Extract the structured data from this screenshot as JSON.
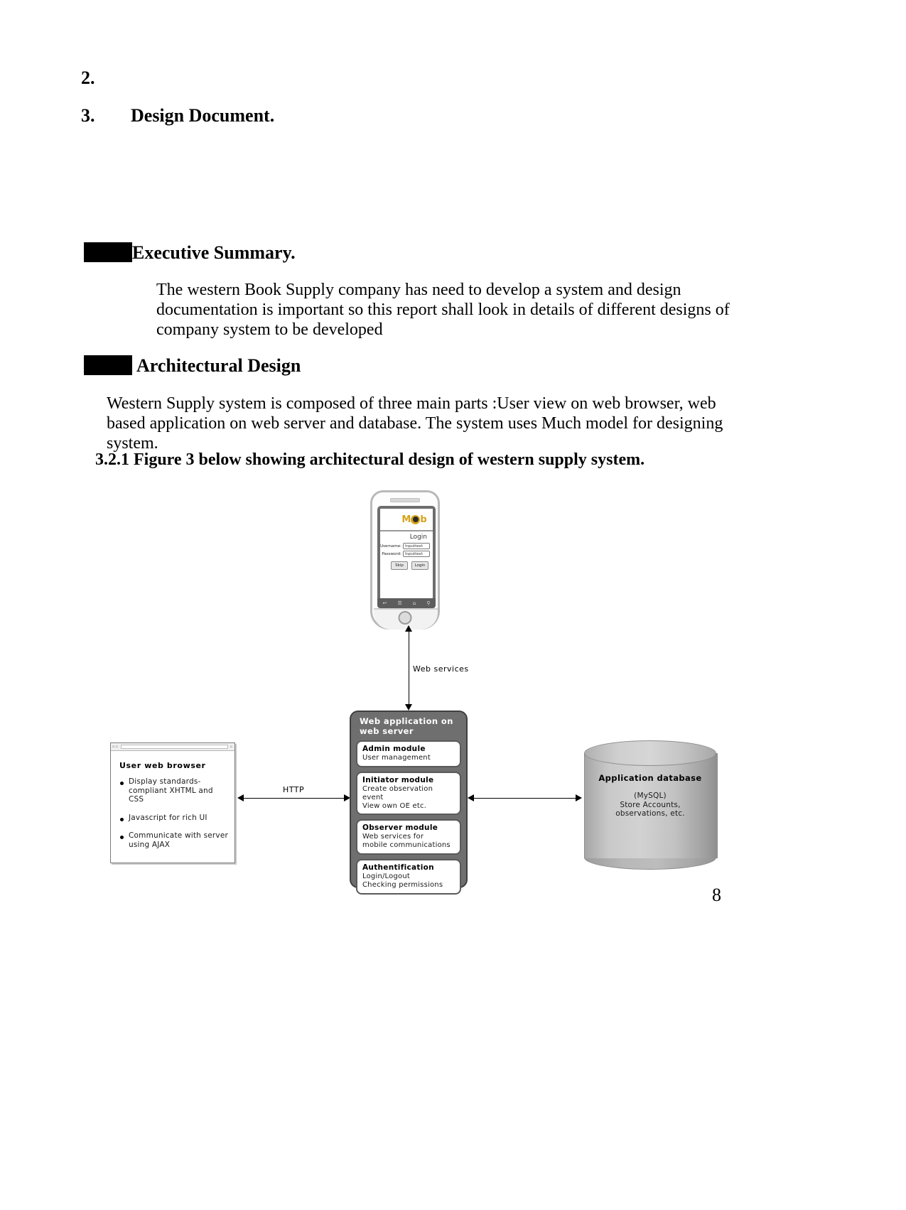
{
  "document": {
    "list_item_2": "2.",
    "section_number": "3.",
    "section_title": "Design Document.",
    "exec_summary_heading": "Executive Summary.",
    "exec_summary_body": "The western Book Supply company  has need to develop a system and design documentation is important so this report shall look in details of different designs of company system to  be developed",
    "arch_design_heading": "Architectural Design",
    "arch_design_body": "Western Supply system is composed of three main parts :User view on web browser, web based application on web server and database. The system uses Much model for designing system.",
    "figure_caption": "3.2.1 Figure 3 below showing architectural design of western supply system.",
    "page_number": "8"
  },
  "diagram": {
    "phone": {
      "logo_left": "M",
      "logo_right": "b",
      "login_title": "Login",
      "username_label": "Username:",
      "username_value": "Inputtext",
      "password_label": "Password:",
      "password_value": "Inputtext",
      "skip_button": "Skip",
      "login_button": "Login",
      "nav_back": "↩",
      "nav_menu": "☰",
      "nav_home": "⌂",
      "nav_search": "⚲"
    },
    "connector_web_services": "Web services",
    "connector_http": "HTTP",
    "browser": {
      "title": "User web browser",
      "bullets": [
        "Display standards-compliant XHTML and CSS",
        "Javascript for rich UI",
        "Communicate with server using AJAX"
      ]
    },
    "server": {
      "title": "Web application on web server",
      "modules": [
        {
          "title": "Admin module",
          "sub": "User management"
        },
        {
          "title": "Initiator module",
          "sub": "Create observation event\nView own OE etc."
        },
        {
          "title": "Observer module",
          "sub": "Web services for\nmobile communications"
        },
        {
          "title": "Authentification",
          "sub": "Login/Logout\nChecking permissions"
        }
      ]
    },
    "database": {
      "title": "Application database",
      "sub": "(MySQL)\nStore Accounts,\nobservations, etc."
    }
  },
  "colors": {
    "logo_gold": "#d6a318",
    "server_fill": "#6f6f6f",
    "redaction": "#000000"
  }
}
